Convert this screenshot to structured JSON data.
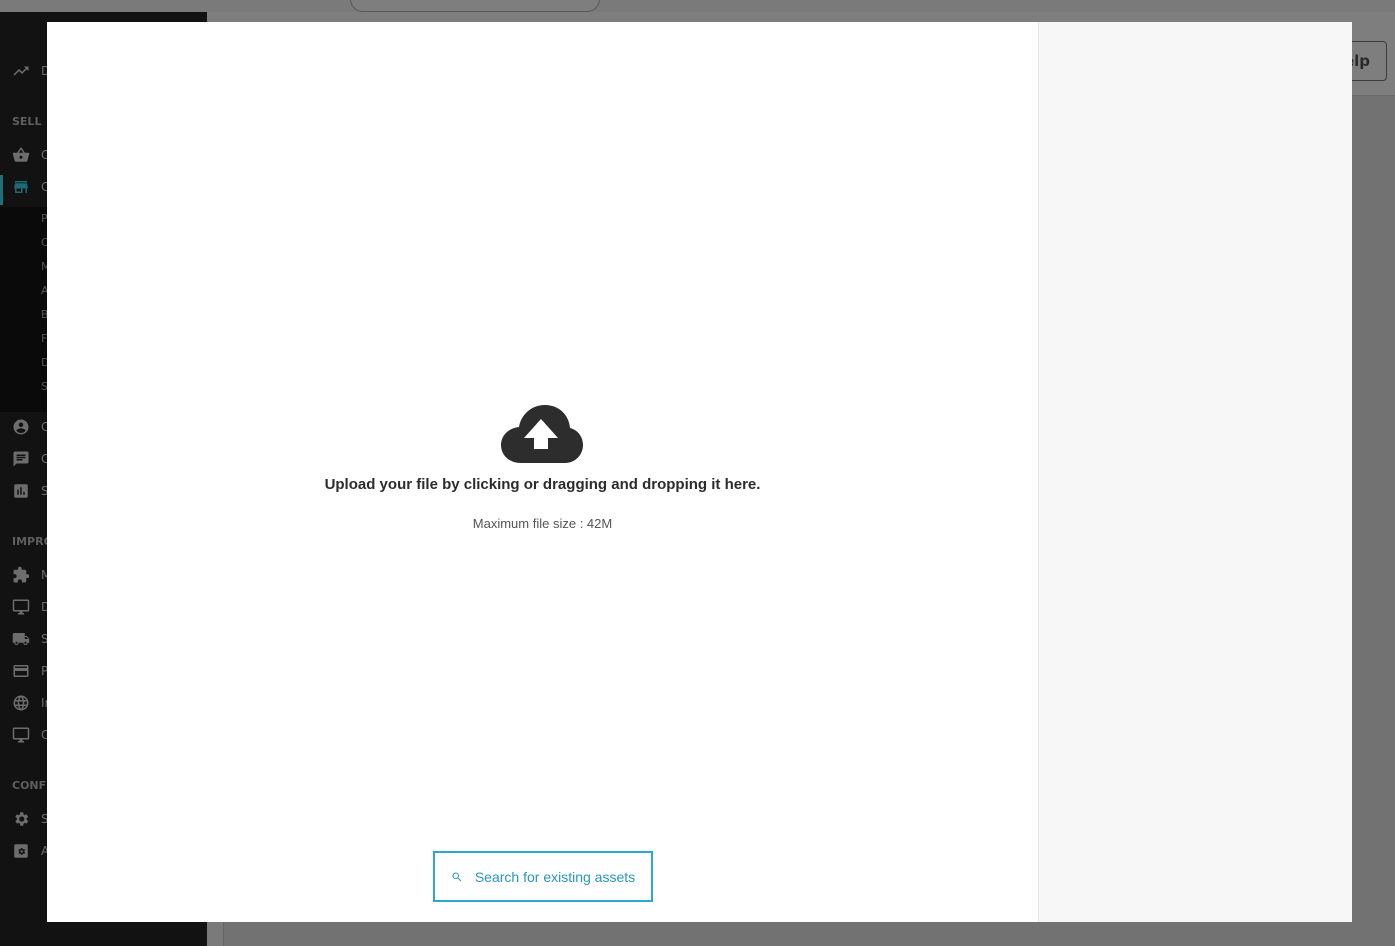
{
  "background": {
    "help_label": "elp",
    "sections": [
      "SELL",
      "IMPRO",
      "CONFI"
    ],
    "nav_letters": [
      "D",
      "O",
      "C",
      "C",
      "C",
      "S",
      "M",
      "D",
      "S",
      "P",
      "Ir",
      "O",
      "S",
      "A"
    ],
    "sub_letters": [
      "P",
      "C",
      "M",
      "A",
      "B",
      "F",
      "D",
      "S"
    ]
  },
  "modal": {
    "upload_title": "Upload your file by clicking or dragging and dropping it here.",
    "upload_subtitle": "Maximum file size : 42M",
    "search_button_label": "Search for existing assets",
    "icons": {
      "upload": "cloud-upload-icon",
      "search": "search-icon"
    }
  },
  "colors": {
    "accent": "#2597bd",
    "sidebar": "#121212",
    "side_panel": "#f7f7f7"
  }
}
